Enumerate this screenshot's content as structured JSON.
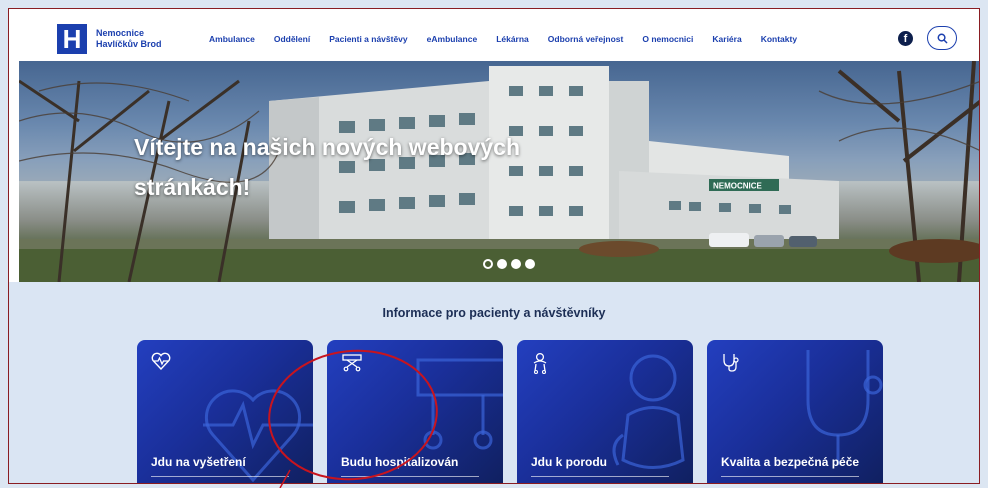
{
  "header": {
    "logo_letter": "H",
    "logo_line1": "Nemocnice",
    "logo_line2": "Havlíčkův Brod",
    "nav": [
      "Ambulance",
      "Oddělení",
      "Pacienti a návštěvy",
      "eAmbulance",
      "Lékárna",
      "Odborná veřejnost",
      "O nemocnici",
      "Kariéra",
      "Kontakty"
    ],
    "facebook_icon": "facebook-icon",
    "search_icon": "search-icon"
  },
  "hero": {
    "title": "Vítejte na našich nových webových stránkách!",
    "building_sign": "NEMOCNICE",
    "slides": 4,
    "active_slide": 1
  },
  "info": {
    "heading": "Informace pro pacienty a návštěvníky",
    "cards": [
      {
        "label": "Jdu na vyšetření",
        "icon": "heart-pulse-icon"
      },
      {
        "label": "Budu hospitalizován",
        "icon": "hospital-bed-icon"
      },
      {
        "label": "Jdu k porodu",
        "icon": "baby-icon"
      },
      {
        "label": "Kvalita a bezpečná péče",
        "icon": "stethoscope-icon"
      }
    ]
  },
  "colors": {
    "brand_blue": "#1b3fae",
    "card_gradient_dark": "#102060",
    "annotation_red": "#c8141e",
    "section_bg": "#dae5f3"
  }
}
